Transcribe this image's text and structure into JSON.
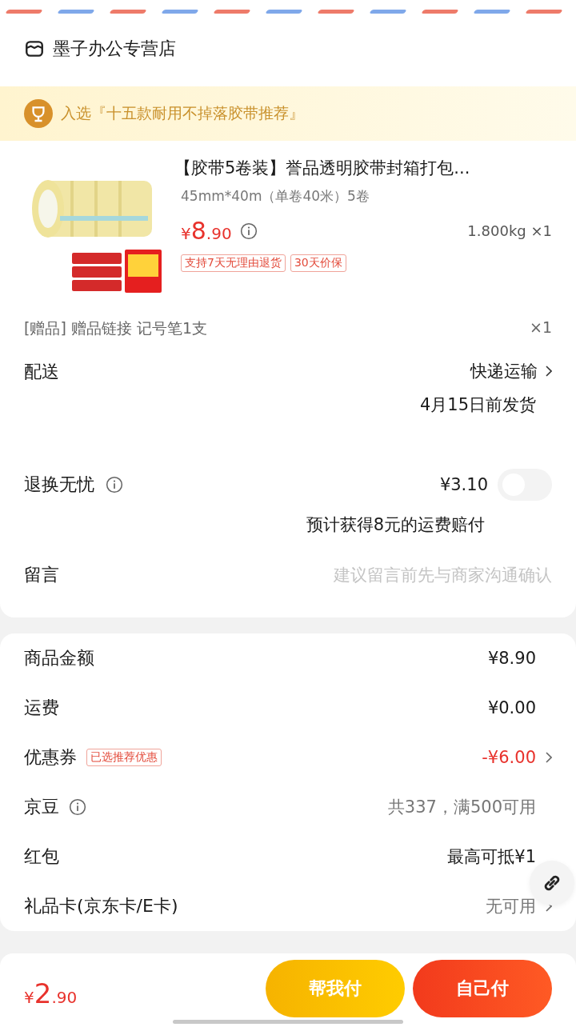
{
  "store": {
    "name": "墨子办公专营店"
  },
  "badge": {
    "text": "入选『十五款耐用不掉落胶带推荐』"
  },
  "product": {
    "kind": "picture",
    "title": "【胶带5卷装】誉品透明胶带封箱打包...",
    "spec": "45mm*40m（单卷40米）5卷",
    "price": {
      "symbol": "¥",
      "integer": "8",
      "decimal": ".90"
    },
    "weight_qty": "1.800kg ×1",
    "tags": [
      "支持7天无理由退货",
      "30天价保"
    ]
  },
  "gift": {
    "label": "[赠品] 赠品链接 记号笔1支",
    "qty": "×1"
  },
  "delivery": {
    "label": "配送",
    "method": "快递运输",
    "date": "4月15日前发货"
  },
  "returns": {
    "label": "退换无忧",
    "price": "¥3.10",
    "on": false,
    "note": "预计获得8元的运费赔付"
  },
  "message": {
    "label": "留言",
    "placeholder": "建议留言前先与商家沟通确认"
  },
  "summary": [
    {
      "label": "商品金额",
      "value": "¥8.90",
      "color": "#1a1a1a",
      "chevron": false
    },
    {
      "label": "运费",
      "value": "¥0.00",
      "color": "#1a1a1a",
      "chevron": false
    },
    {
      "label": "优惠券",
      "tag": "已选推荐优惠",
      "value": "-¥6.00",
      "color": "#e8322c",
      "chevron": true
    },
    {
      "label": "京豆",
      "info": true,
      "value": "共337，满500可用",
      "color": "#777777",
      "chevron": false
    },
    {
      "label": "红包",
      "value": "最高可抵¥1",
      "color": "#1a1a1a",
      "chevron": false
    },
    {
      "label": "礼品卡(京东卡/E卡)",
      "value": "无可用",
      "color": "#777777",
      "chevron": true
    }
  ],
  "bottom": {
    "price": {
      "symbol": "¥",
      "integer": "2",
      "decimal": ".90"
    },
    "buttons": [
      {
        "kind": "help",
        "label": "帮我付"
      },
      {
        "kind": "self",
        "label": "自己付"
      }
    ]
  }
}
